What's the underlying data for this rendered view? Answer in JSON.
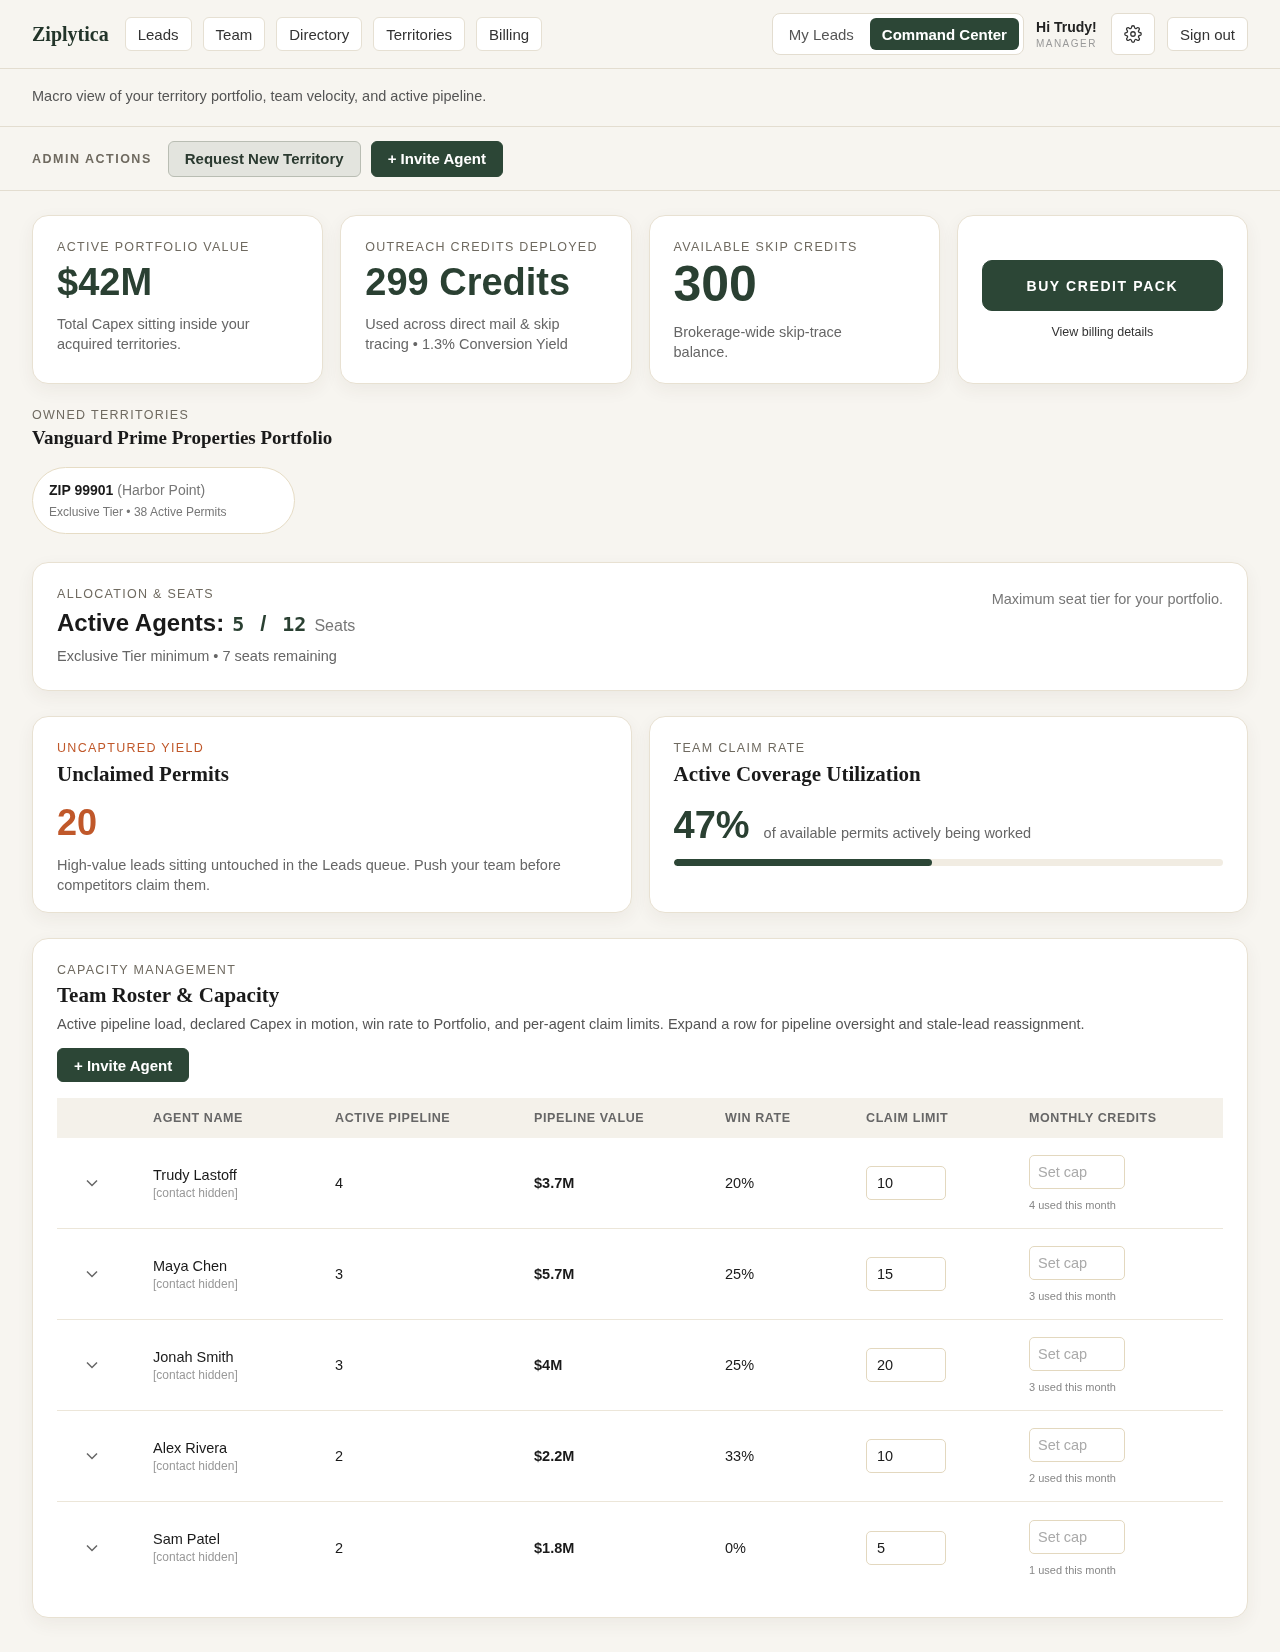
{
  "brand": "Ziplytica",
  "nav": [
    {
      "label": "Leads",
      "selected": false
    },
    {
      "label": "Team",
      "selected": false
    },
    {
      "label": "Directory",
      "selected": false
    },
    {
      "label": "Territories",
      "selected": false
    },
    {
      "label": "Billing",
      "selected": false
    }
  ],
  "view_toggle": [
    {
      "label": "My Leads",
      "selected": false
    },
    {
      "label": "Command Center",
      "selected": true
    }
  ],
  "user": {
    "greeting": "Hi Trudy!",
    "role": "MANAGER"
  },
  "sign_out": "Sign out",
  "page": {
    "subtitle": "Macro view of your territory portfolio, team velocity, and active pipeline."
  },
  "admin_actions": {
    "label": "ADMIN ACTIONS",
    "buttons": [
      {
        "label": "Request New Territory",
        "kind": "secondary"
      },
      {
        "label": "+ Invite Agent",
        "kind": "primary"
      }
    ]
  },
  "stats": [
    {
      "kind": "stat",
      "label": "ACTIVE PORTFOLIO VALUE",
      "value": "$42M",
      "note": "Total Capex sitting inside your acquired territories."
    },
    {
      "kind": "stat",
      "label": "OUTREACH CREDITS DEPLOYED",
      "value": "299 Credits",
      "note": "Used across direct mail & skip tracing • 1.3% Conversion Yield"
    },
    {
      "kind": "stat",
      "label": "AVAILABLE SKIP CREDITS",
      "value": "300",
      "note": "Brokerage-wide skip-trace balance."
    },
    {
      "kind": "action",
      "button": "BUY CREDIT PACK",
      "link": "View billing details"
    }
  ],
  "territories": {
    "label": "OWNED TERRITORIES",
    "title": "Vanguard Prime Properties Portfolio",
    "items": [
      {
        "zip": "ZIP 99901",
        "area": "(Harbor Point)",
        "detail": "Exclusive Tier • 38 Active Permits"
      }
    ]
  },
  "seats": {
    "label": "ALLOCATION & SEATS",
    "title": "Active Agents:",
    "active": "5",
    "separator": "/",
    "total": "12",
    "unit": "Seats",
    "note": "Exclusive Tier minimum • 7 seats remaining",
    "aside": "Maximum seat tier for your portfolio."
  },
  "metrics": [
    {
      "kind": "count",
      "label": "UNCAPTURED YIELD",
      "title": "Unclaimed Permits",
      "value": "20",
      "note": "High-value leads sitting untouched in the Leads queue. Push your team before competitors claim them."
    },
    {
      "kind": "progress",
      "label": "TEAM CLAIM RATE",
      "title": "Active Coverage Utilization",
      "value": "47%",
      "note": "of available permits actively being worked",
      "level": 0.47
    }
  ],
  "roster": {
    "label": "CAPACITY MANAGEMENT",
    "title": "Team Roster & Capacity",
    "description": "Active pipeline load, declared Capex in motion, win rate to Portfolio, and per-agent claim limits. Expand a row for pipeline oversight and stale-lead reassignment.",
    "button": "+ Invite Agent",
    "columns": [
      "AGENT NAME",
      "ACTIVE PIPELINE",
      "PIPELINE VALUE",
      "WIN RATE",
      "CLAIM LIMIT",
      "MONTHLY CREDITS"
    ],
    "rows": [
      {
        "name": "Trudy Lastoff",
        "contact": "[contact hidden]",
        "pipeline": "4",
        "value": "$3.7M",
        "win_rate": "20%",
        "claim_limit": "10",
        "credits_placeholder": "Set cap",
        "credits_used": "4 used this month"
      },
      {
        "name": "Maya Chen",
        "contact": "[contact hidden]",
        "pipeline": "3",
        "value": "$5.7M",
        "win_rate": "25%",
        "claim_limit": "15",
        "credits_placeholder": "Set cap",
        "credits_used": "3 used this month"
      },
      {
        "name": "Jonah Smith",
        "contact": "[contact hidden]",
        "pipeline": "3",
        "value": "$4M",
        "win_rate": "25%",
        "claim_limit": "20",
        "credits_placeholder": "Set cap",
        "credits_used": "3 used this month"
      },
      {
        "name": "Alex Rivera",
        "contact": "[contact hidden]",
        "pipeline": "2",
        "value": "$2.2M",
        "win_rate": "33%",
        "claim_limit": "10",
        "credits_placeholder": "Set cap",
        "credits_used": "2 used this month"
      },
      {
        "name": "Sam Patel",
        "contact": "[contact hidden]",
        "pipeline": "2",
        "value": "$1.8M",
        "win_rate": "0%",
        "claim_limit": "5",
        "credits_placeholder": "Set cap",
        "credits_used": "1 used this month"
      }
    ]
  }
}
